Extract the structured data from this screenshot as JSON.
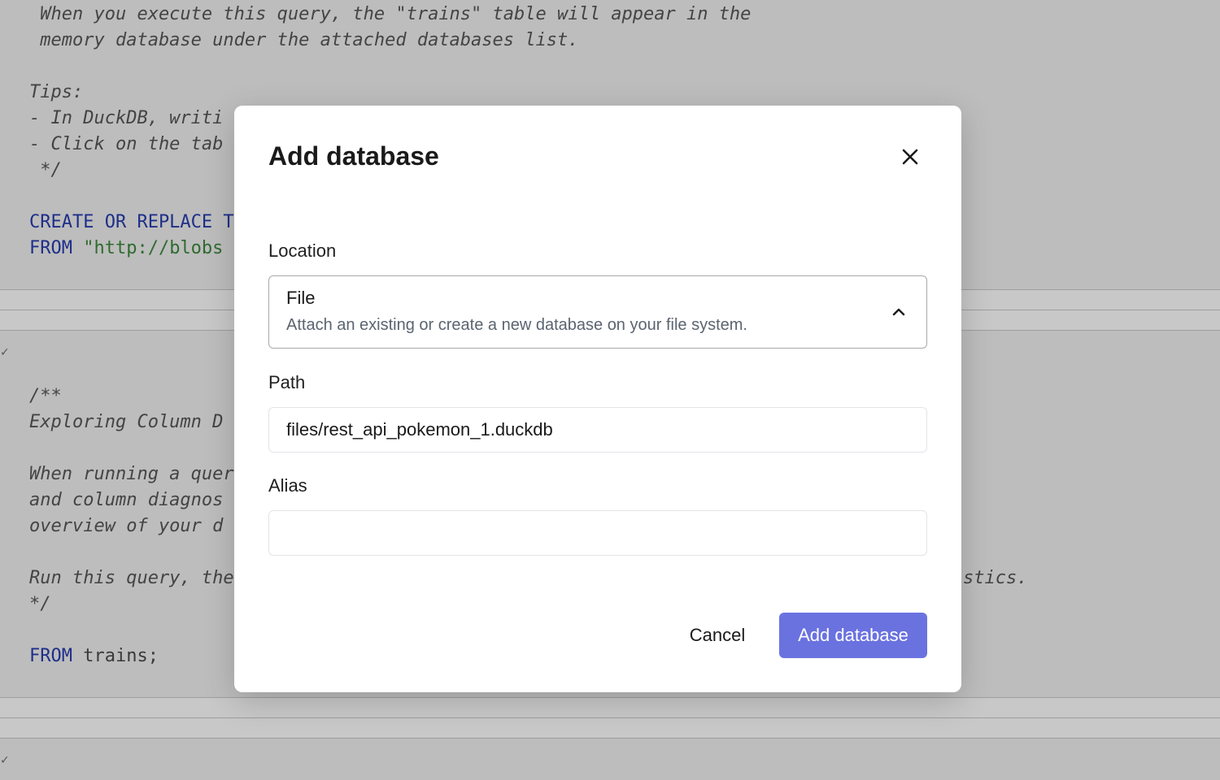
{
  "editor": {
    "lines": [
      " When you execute this query, the \"trains\" table will appear in the",
      " memory database under the attached databases list.",
      "Tips:",
      "- In DuckDB, writi",
      "- Click on the tab",
      " */",
      "/**",
      "Exploring Column D",
      "When running a quer",
      "and column diagnos",
      "overview of your d",
      "Run this query, the",
      "stics.",
      "*/"
    ],
    "sql1_kw": "CREATE OR REPLACE T",
    "sql2_kw": "FROM",
    "sql2_str": "\"http://blobs",
    "sql3_kw": "FROM",
    "sql3_rest": " trains;",
    "check_mark": "✓"
  },
  "dialog": {
    "title": "Add database",
    "location_label": "Location",
    "location_value_title": "File",
    "location_value_desc": "Attach an existing or create a new database on your file system.",
    "path_label": "Path",
    "path_value": "files/rest_api_pokemon_1.duckdb",
    "alias_label": "Alias",
    "alias_value": "",
    "cancel_label": "Cancel",
    "submit_label": "Add database"
  },
  "colors": {
    "primary": "#6a72e0",
    "backdrop": "#bdbdbd"
  },
  "icons": {
    "close": "close-icon",
    "chevron": "chevron-up-icon"
  }
}
